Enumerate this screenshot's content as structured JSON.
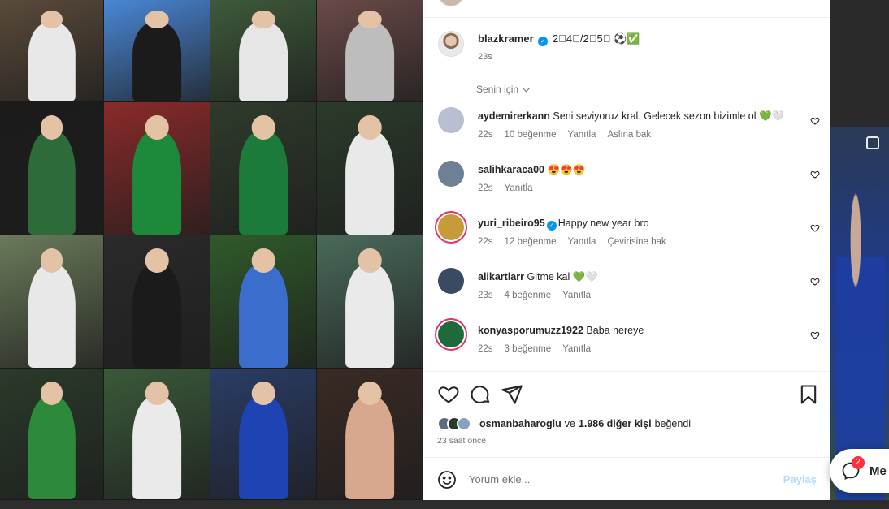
{
  "post": {
    "author": "blazkramer",
    "caption": "2⃣4⃣/2⃣5⃣ ⚽️✅",
    "time": "23s",
    "sort_label": "Senin için"
  },
  "comments": [
    {
      "user": "aydemirerkann",
      "verified": false,
      "text": "Seni seviyoruz kral. Gelecek sezon bizimle ol 💚🤍",
      "time": "22s",
      "likes": "10 beğenme",
      "reply": "Yanıtla",
      "extra": "Aslına bak",
      "avatar_color": "#b8bfd0"
    },
    {
      "user": "salihkaraca00",
      "verified": false,
      "text": "😍😍😍",
      "time": "22s",
      "likes": "",
      "reply": "Yanıtla",
      "extra": "",
      "avatar_color": "#6f7f94"
    },
    {
      "user": "yuri_ribeiro95",
      "verified": true,
      "text": "Happy new year bro",
      "time": "22s",
      "likes": "12 beğenme",
      "reply": "Yanıtla",
      "extra": "Çevirisine bak",
      "avatar_color": "#c79a3a"
    },
    {
      "user": "alikartlarr",
      "verified": false,
      "text": "Gitme kal 💚🤍",
      "time": "23s",
      "likes": "4 beğenme",
      "reply": "Yanıtla",
      "extra": "",
      "avatar_color": "#3b4a63"
    },
    {
      "user": "konyasporumuzz1922",
      "verified": false,
      "text": "Baba nereye",
      "time": "22s",
      "likes": "3 beğenme",
      "reply": "Yanıtla",
      "extra": "",
      "avatar_color": "#1f6a3a"
    }
  ],
  "likes": {
    "liked_by": "osmanbaharoglu",
    "connector": "ve",
    "others": "1.986 diğer kişi",
    "suffix": "beğendi",
    "posted": "23 saat önce"
  },
  "add_comment": {
    "placeholder": "Yorum ekle...",
    "share_label": "Paylaş"
  },
  "messages": {
    "badge": "2",
    "label": "Me"
  },
  "grid_tiles": [
    {
      "bg": "#5a4a3a",
      "accent": "#e8e8e8"
    },
    {
      "bg": "#4a87d6",
      "accent": "#1b1b1b"
    },
    {
      "bg": "#3e5a3a",
      "accent": "#e6e6e6"
    },
    {
      "bg": "#6a4a48",
      "accent": "#bdbdbd"
    },
    {
      "bg": "#1b1b1b",
      "accent": "#2e6b3a"
    },
    {
      "bg": "#8a2a2a",
      "accent": "#1d8a3b"
    },
    {
      "bg": "#2f3a2b",
      "accent": "#1c7a3b"
    },
    {
      "bg": "#2b3b2a",
      "accent": "#e9e9e9"
    },
    {
      "bg": "#6a7a5a",
      "accent": "#e8e8e8"
    },
    {
      "bg": "#2a2a2a",
      "accent": "#1b1b1b"
    },
    {
      "bg": "#2f5a2a",
      "accent": "#3b6ecc"
    },
    {
      "bg": "#4a6a5a",
      "accent": "#eaeaea"
    },
    {
      "bg": "#2a3a2a",
      "accent": "#2e8a3b"
    },
    {
      "bg": "#3a5a3a",
      "accent": "#eaeaea"
    },
    {
      "bg": "#2a3d66",
      "accent": "#1e44b3"
    },
    {
      "bg": "#3a2a24",
      "accent": "#d8a88e"
    }
  ]
}
